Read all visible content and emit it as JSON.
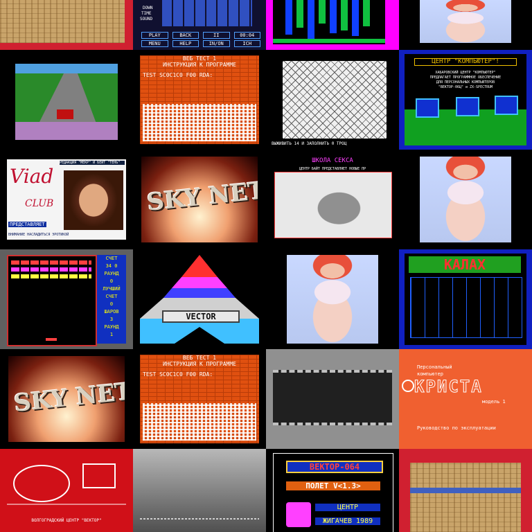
{
  "tiles": {
    "menu": {
      "keys": [
        "PLAY",
        "BACK",
        "II",
        "00:04",
        "MENU",
        "HELP",
        "IN/ON",
        "ICH"
      ],
      "side_labels": [
        "DOWN",
        "TIME",
        "SOUND"
      ]
    },
    "centr": {
      "title": "ЦЕНТР \"КОМПЬЮТЕР\"!",
      "lines": [
        "ХАБАРОВСКИЙ ЦЕНТР \"КОМПЬЮТЕР\"",
        "ПРЕДЛАГАЕТ ПРОГРАММНОЕ ОБЕСПЕЧЕНИЕ",
        "ДЛЯ ПЕРСОНАЛЬНЫХ КОМПЬЮТЕРОВ",
        "\"ВЕКТОР-06Ц\" и ZX-SPECTRUM"
      ]
    },
    "test_a": {
      "title": "ВЕБ ТЕСТ 1",
      "sub": "ИНСТРУКЦИЯ К ПРОГРАММЕ",
      "line": "TEST SC0C1C0 F00 RDA:"
    },
    "test_b": {
      "title": "ВЕБ ТЕСТ 1",
      "sub": "ИНСТРУКЦИЯ К ПРОГРАММЕ",
      "line": "TEST SC0C1C0 F00 RDA:"
    },
    "maze": {
      "footer": "ВЫЖИВИТЬ 14 И ЗАПОЛНИТЬ 0 ТРОЦ"
    },
    "viad": {
      "logo": "Viad",
      "club": "CLUB",
      "header": "РЕДАКЦИЯ \"МЕКР\" И БЕЙТ \"ТЕНЬ\"",
      "present": "ПРЕДСТАВЛЯЕТ",
      "footer": "ВНИМАНИЕ НАСЛАДИТЬСЯ ЭРОТИКОЙ"
    },
    "skynet_1": {
      "logo": "SKY NET"
    },
    "skynet_2": {
      "logo": "SKY NET"
    },
    "shkola": {
      "title": "ШКОЛА СЕКСА",
      "sub": "ЦЕНТР БАЙТ ПРЕДСТАВЛЯЕТ НОВЫЕ ПР"
    },
    "breakout": {
      "stats": [
        "СЧЕТ",
        "34 0",
        "РАУНД",
        "0",
        "ЛУЧШИЙ",
        "СЧЕТ",
        "0",
        "ШАРОВ",
        "3",
        "РАУНД",
        "1"
      ]
    },
    "vector": {
      "label": "VECTOR"
    },
    "kalah": {
      "title": "КАЛАХ"
    },
    "kristall": {
      "small1": "Персональный",
      "small2": "компьютер",
      "logo": "КРИСТА",
      "model": "модель 1",
      "guide": "Руководство по эксплуатации"
    },
    "centr_vector": {
      "footer": "ВОЛГОГРАДСКИЙ ЦЕНТР \"ВЕКТОР\""
    },
    "vector064": {
      "title": "ВЕКТОР-064",
      "game": "ПОЛЕТ V<1.3>",
      "company": "ЦЕНТР",
      "city": "ЖИГАЧЕВ 1989"
    }
  },
  "colors": {
    "brick": "#e05010",
    "blue_frame": "#1020c0",
    "magenta": "#ff00ff",
    "red_bg": "#d01018"
  }
}
